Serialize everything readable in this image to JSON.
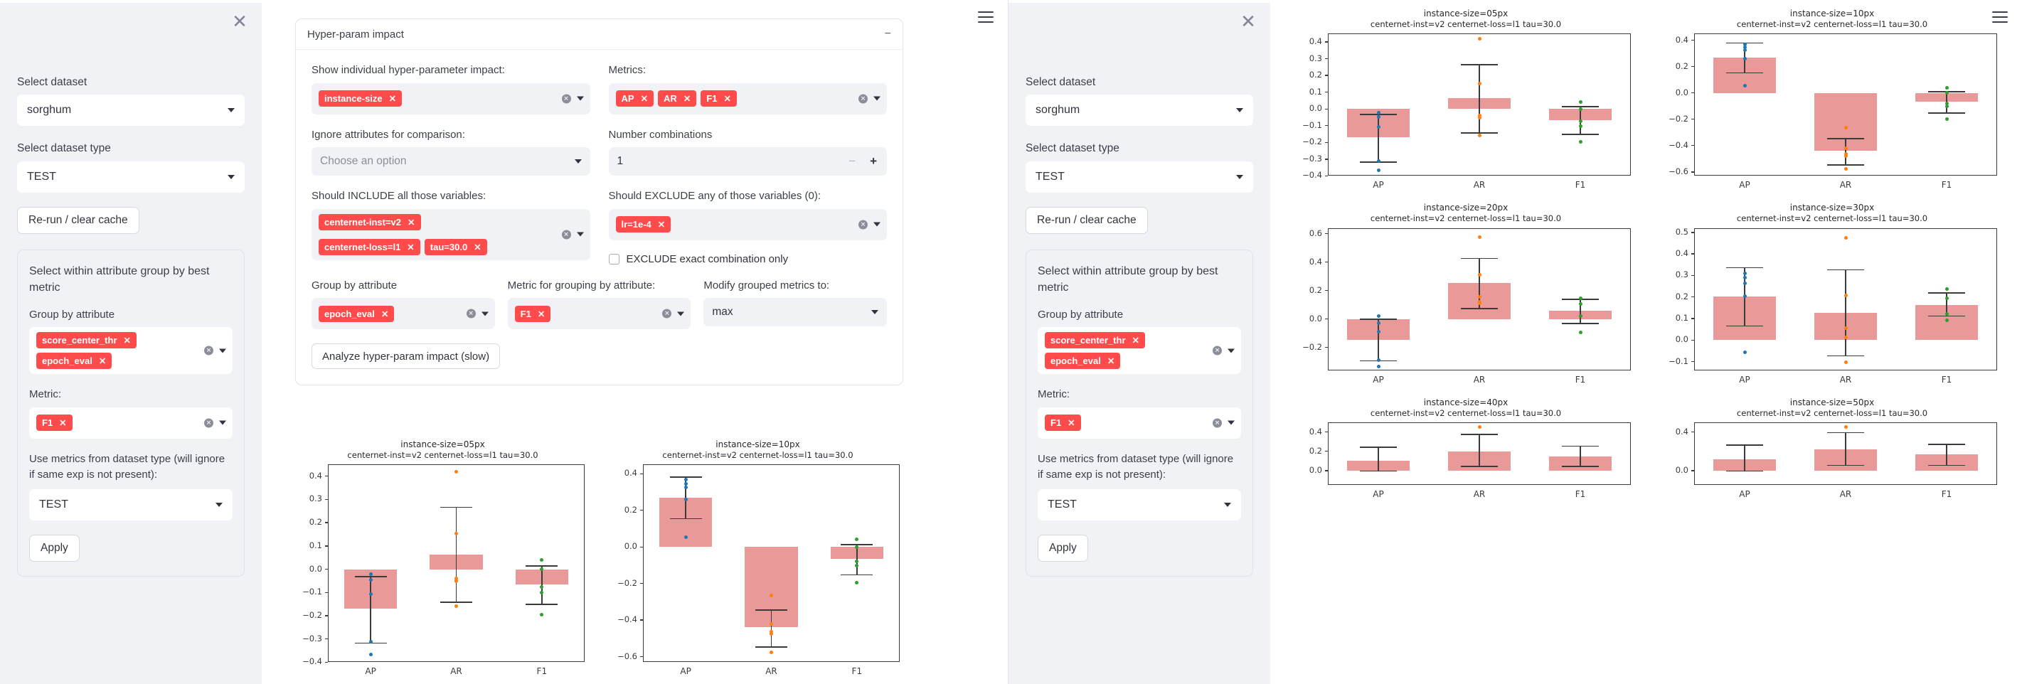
{
  "theme": {
    "primary": "#ff4b4b",
    "bar": "#ea9999",
    "sidebar_bg": "#f0f2f6"
  },
  "sidebar": {
    "close_icon": "close-icon",
    "dataset_label": "Select dataset",
    "dataset_value": "sorghum",
    "dataset_type_label": "Select dataset type",
    "dataset_type_value": "TEST",
    "rerun_button": "Re-run / clear cache",
    "group_title": "Select within attribute group by best metric",
    "group_by_label": "Group by attribute",
    "group_by_chips": [
      "score_center_thr",
      "epoch_eval"
    ],
    "metric_label": "Metric:",
    "metric_chips": [
      "F1"
    ],
    "use_metrics_label": "Use metrics from dataset type (will ignore if same exp is not present):",
    "use_metrics_value": "TEST",
    "apply_button": "Apply"
  },
  "expander": {
    "title": "Hyper-param impact",
    "collapse_icon": "minus-icon",
    "show_individual_label": "Show individual hyper-parameter impact:",
    "show_individual_chips": [
      "instance-size"
    ],
    "metrics_label": "Metrics:",
    "metrics_chips": [
      "AP",
      "AR",
      "F1"
    ],
    "ignore_label": "Ignore attributes for comparison:",
    "ignore_placeholder": "Choose an option",
    "numcomb_label": "Number combinations",
    "numcomb_value": "1",
    "numcomb_minus": "−",
    "numcomb_plus": "+",
    "include_label": "Should INCLUDE all those variables:",
    "include_chips": [
      "centernet-inst=v2",
      "centernet-loss=l1",
      "tau=30.0"
    ],
    "exclude_label": "Should EXCLUDE any of those variables (0):",
    "exclude_chips": [
      "lr=1e-4"
    ],
    "exclude_exact_label": "EXCLUDE exact combination only",
    "groupby_label": "Group by attribute",
    "groupby_chips": [
      "epoch_eval"
    ],
    "metric_group_label": "Metric for grouping by attribute:",
    "metric_group_chips": [
      "F1"
    ],
    "modify_label": "Modify grouped metrics to:",
    "modify_value": "max",
    "analyze_button": "Analyze hyper-param impact (slow)"
  },
  "menu_icon": "hamburger-menu-icon",
  "chart_data": [
    {
      "id": "c05",
      "type": "bar",
      "title": "instance-size=05px",
      "subtitle": "centernet-inst=v2  centernet-loss=l1  tau=30.0",
      "categories": [
        "AP",
        "AR",
        "F1"
      ],
      "values": [
        -0.17,
        0.064,
        -0.066
      ],
      "err_low": [
        -0.315,
        -0.14,
        -0.149
      ],
      "err_high": [
        -0.03,
        0.269,
        0.016
      ],
      "ylim": [
        -0.4,
        0.45
      ],
      "yticks": [
        -0.4,
        -0.3,
        -0.2,
        -0.1,
        0.0,
        0.1,
        0.2,
        0.3,
        0.4
      ],
      "points": [
        {
          "cat": 0,
          "vals": [
            -0.021,
            -0.046,
            -0.107,
            -0.313,
            -0.367
          ],
          "color": "#1f77b4"
        },
        {
          "cat": 1,
          "vals": [
            0.419,
            0.154,
            -0.04,
            -0.05,
            -0.053,
            -0.158
          ],
          "color": "#ff7f0e"
        },
        {
          "cat": 2,
          "vals": [
            0.041,
            0.0,
            -0.075,
            -0.102,
            -0.196
          ],
          "color": "#2ca02c"
        }
      ]
    },
    {
      "id": "c10",
      "type": "bar",
      "title": "instance-size=10px",
      "subtitle": "centernet-inst=v2  centernet-loss=l1  tau=30.0",
      "categories": [
        "AP",
        "AR",
        "F1"
      ],
      "values": [
        0.27,
        -0.44,
        -0.066
      ],
      "err_low": [
        0.157,
        -0.543,
        -0.149
      ],
      "err_high": [
        0.384,
        -0.342,
        0.015
      ],
      "ylim": [
        -0.63,
        0.45
      ],
      "yticks": [
        -0.6,
        -0.4,
        -0.2,
        0.0,
        0.2,
        0.4
      ],
      "points": [
        {
          "cat": 0,
          "vals": [
            0.368,
            0.345,
            0.326,
            0.26,
            0.055
          ],
          "color": "#1f77b4"
        },
        {
          "cat": 1,
          "vals": [
            -0.266,
            -0.42,
            -0.464,
            -0.477,
            -0.578
          ],
          "color": "#ff7f0e"
        },
        {
          "cat": 2,
          "vals": [
            0.04,
            0.0,
            -0.078,
            -0.102,
            -0.196
          ],
          "color": "#2ca02c"
        }
      ]
    },
    {
      "id": "c20",
      "type": "bar",
      "title": "instance-size=20px",
      "subtitle": "centernet-inst=v2  centernet-loss=l1  tau=30.0",
      "categories": [
        "AP",
        "AR",
        "F1"
      ],
      "values": [
        -0.145,
        0.253,
        0.057
      ],
      "err_low": [
        -0.29,
        0.078,
        -0.027
      ],
      "err_high": [
        0.003,
        0.43,
        0.143
      ],
      "ylim": [
        -0.36,
        0.64
      ],
      "yticks": [
        -0.2,
        0.0,
        0.2,
        0.4,
        0.6
      ],
      "points": [
        {
          "cat": 0,
          "vals": [
            0.023,
            -0.028,
            -0.088,
            -0.29,
            -0.335
          ],
          "color": "#1f77b4"
        },
        {
          "cat": 1,
          "vals": [
            0.578,
            0.31,
            0.158,
            0.122,
            0.112
          ],
          "color": "#ff7f0e"
        },
        {
          "cat": 2,
          "vals": [
            0.145,
            0.105,
            0.022,
            -0.095
          ],
          "color": "#2ca02c"
        }
      ]
    },
    {
      "id": "c30",
      "type": "bar",
      "title": "instance-size=30px",
      "subtitle": "centernet-inst=v2  centernet-loss=l1  tau=30.0",
      "categories": [
        "AP",
        "AR",
        "F1"
      ],
      "values": [
        0.204,
        0.128,
        0.164
      ],
      "err_low": [
        0.068,
        -0.07,
        0.114
      ],
      "err_high": [
        0.338,
        0.329,
        0.221
      ],
      "ylim": [
        -0.14,
        0.52
      ],
      "yticks": [
        -0.1,
        0.0,
        0.1,
        0.2,
        0.3,
        0.4,
        0.5
      ],
      "points": [
        {
          "cat": 0,
          "vals": [
            0.311,
            0.289,
            0.264,
            0.205,
            -0.056
          ],
          "color": "#1f77b4"
        },
        {
          "cat": 1,
          "vals": [
            0.475,
            0.207,
            0.055,
            0.013,
            -0.104
          ],
          "color": "#ff7f0e"
        },
        {
          "cat": 2,
          "vals": [
            0.236,
            0.193,
            0.121,
            0.093
          ],
          "color": "#2ca02c"
        }
      ]
    },
    {
      "id": "c40",
      "type": "bar",
      "title": "instance-size=40px",
      "subtitle": "centernet-inst=v2  centernet-loss=l1  tau=30.0",
      "categories": [
        "AP",
        "AR",
        "F1"
      ],
      "values": [
        0.1,
        0.2,
        0.15
      ],
      "err_low": [
        0.0,
        0.05,
        0.05
      ],
      "err_high": [
        0.25,
        0.38,
        0.26
      ],
      "ylim": [
        -0.15,
        0.5
      ],
      "yticks": [
        0.0,
        0.2,
        0.4
      ],
      "points": [
        {
          "cat": 1,
          "vals": [
            0.45
          ],
          "color": "#ff7f0e"
        }
      ]
    },
    {
      "id": "c50",
      "type": "bar",
      "title": "instance-size=50px",
      "subtitle": "centernet-inst=v2  centernet-loss=l1  tau=30.0",
      "categories": [
        "AP",
        "AR",
        "F1"
      ],
      "values": [
        0.12,
        0.22,
        0.17
      ],
      "err_low": [
        0.0,
        0.06,
        0.06
      ],
      "err_high": [
        0.27,
        0.4,
        0.28
      ],
      "ylim": [
        -0.15,
        0.5
      ],
      "yticks": [
        0.0,
        0.4
      ],
      "points": [
        {
          "cat": 1,
          "vals": [
            0.45
          ],
          "color": "#ff7f0e"
        }
      ]
    }
  ]
}
